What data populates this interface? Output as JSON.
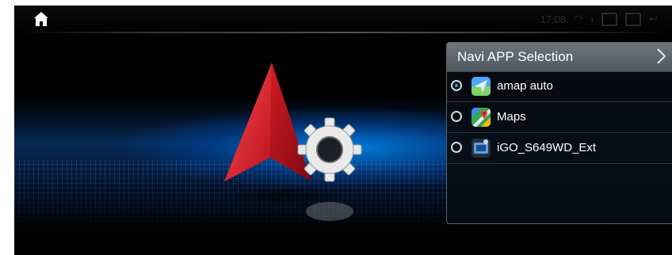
{
  "statusbar": {
    "time": "17:08"
  },
  "navi_panel": {
    "title": "Navi APP Selection",
    "options": [
      {
        "label": "amap auto",
        "selected": true,
        "icon": "amap-auto-icon"
      },
      {
        "label": "Maps",
        "selected": false,
        "icon": "google-maps-icon"
      },
      {
        "label": "iGO_S649WD_Ext",
        "selected": false,
        "icon": "igo-icon"
      }
    ]
  },
  "colors": {
    "accent": "#2fa6ff",
    "arrow_red": "#e0202a",
    "header_gray": "#5f676f"
  }
}
